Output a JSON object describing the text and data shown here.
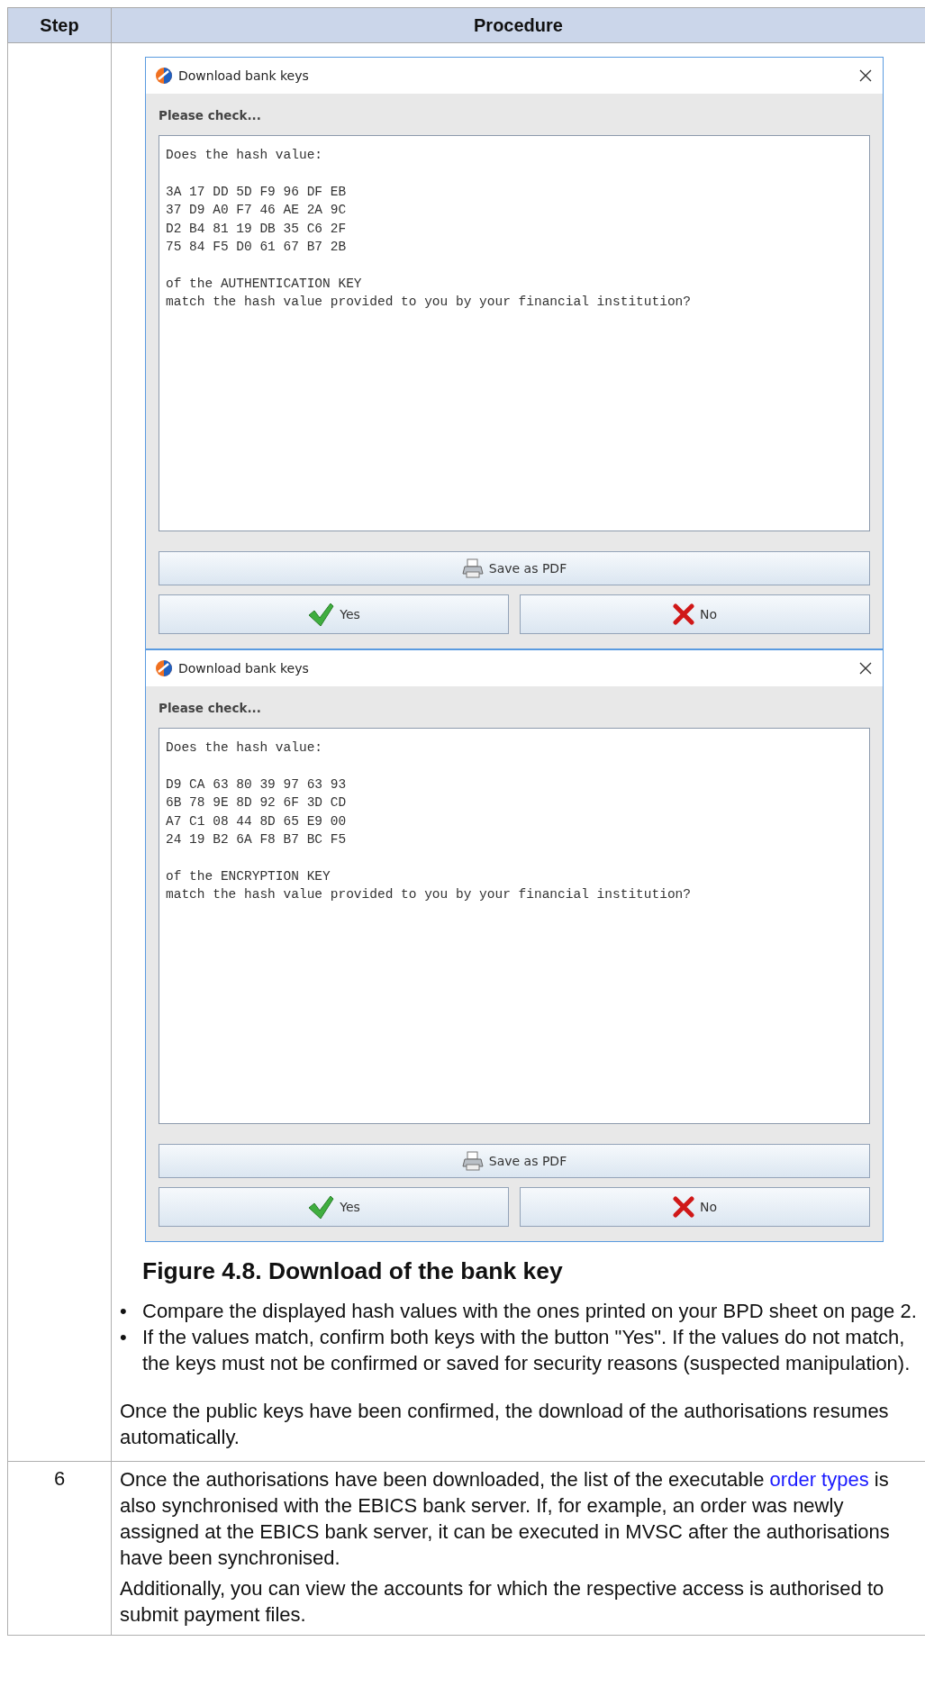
{
  "table": {
    "columns": [
      "Step",
      "Procedure"
    ],
    "rows": [
      {
        "step": "",
        "dialogs": [
          {
            "title": "Download bank keys",
            "heading": "Please check...",
            "text_blocks": [
              [
                "Does the hash value:"
              ],
              [
                "3A 17 DD 5D F9 96 DF EB",
                "37 D9 A0 F7 46 AE 2A 9C",
                "D2 B4 81 19 DB 35 C6 2F",
                "75 84 F5 D0 61 67 B7 2B"
              ],
              [
                "of the AUTHENTICATION KEY",
                "match the hash value provided to you by your financial institution?"
              ]
            ],
            "buttons": [
              {
                "label": "Save as PDF",
                "kind": "pdf"
              },
              {
                "label": "Yes",
                "kind": "yes"
              },
              {
                "label": "No",
                "kind": "no"
              }
            ]
          },
          {
            "title": "Download bank keys",
            "heading": "Please check...",
            "text_blocks": [
              [
                "Does the hash value:"
              ],
              [
                "D9 CA 63 80 39 97 63 93",
                "6B 78 9E 8D 92 6F 3D CD",
                "A7 C1 08 44 8D 65 E9 00",
                "24 19 B2 6A F8 B7 BC F5"
              ],
              [
                "of the ENCRYPTION KEY",
                "match the hash value provided to you by your financial institution?"
              ]
            ],
            "buttons": [
              {
                "label": "Save as PDF",
                "kind": "pdf"
              },
              {
                "label": "Yes",
                "kind": "yes"
              },
              {
                "label": "No",
                "kind": "no"
              }
            ]
          }
        ],
        "figure_caption": "Figure 4.8. Download of the bank key",
        "bullets": [
          {
            "marker": "•",
            "text": "Compare the displayed hash values with the ones printed on your BPD sheet on page 2."
          },
          {
            "marker": "•",
            "text": "If the values match, confirm both keys with the button \"Yes\". If the values do not match, the keys must not be confirmed or saved for security reasons (suspected manipulation)."
          }
        ],
        "paragraphs": [
          [
            {
              "kind": "text",
              "text": "Once the public keys have been confirmed, the download of the authorisations resumes automatically."
            }
          ]
        ]
      },
      {
        "step": "6",
        "paragraphs": [
          [
            {
              "kind": "text",
              "text": "Once the authorisations have been downloaded, the list of the executable "
            },
            {
              "kind": "link",
              "text": "order types"
            },
            {
              "kind": "text",
              "text": " is also synchronised with the EBICS bank server. If, for example, an order was newly assigned at the EBICS bank server, it can be executed in MVSC after the authorisations have been synchronised."
            }
          ],
          [
            {
              "kind": "text",
              "text": "Additionally, you can view the accounts for which the respective access is authorised to submit payment files."
            }
          ]
        ]
      }
    ]
  }
}
